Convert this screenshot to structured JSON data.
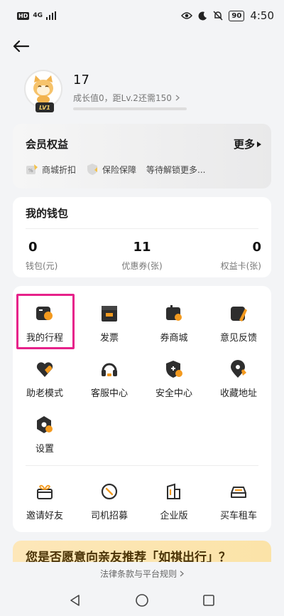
{
  "status_bar": {
    "network_badge": "HD",
    "network_type": "4G",
    "battery": "90",
    "time": "4:50"
  },
  "profile": {
    "username": "17",
    "growth_text": "成长值0，距Lv.2还需150",
    "level_badge": "LV1",
    "growth_progress": 0
  },
  "member": {
    "title": "会员权益",
    "more_label": "更多",
    "perks": [
      "商城折扣",
      "保险保障",
      "等待解锁更多..."
    ]
  },
  "wallet": {
    "title": "我的钱包",
    "stats": [
      {
        "value": "0",
        "label": "钱包(元)"
      },
      {
        "value": "11",
        "label": "优惠券(张)"
      },
      {
        "value": "0",
        "label": "权益卡(张)"
      }
    ]
  },
  "services": [
    {
      "label": "我的行程",
      "icon": "trip-icon"
    },
    {
      "label": "发票",
      "icon": "invoice-icon"
    },
    {
      "label": "券商城",
      "icon": "coupon-mall-icon"
    },
    {
      "label": "意见反馈",
      "icon": "feedback-icon"
    },
    {
      "label": "助老模式",
      "icon": "elder-mode-icon"
    },
    {
      "label": "客服中心",
      "icon": "headset-icon"
    },
    {
      "label": "安全中心",
      "icon": "shield-icon"
    },
    {
      "label": "收藏地址",
      "icon": "location-pin-icon"
    },
    {
      "label": "设置",
      "icon": "settings-icon"
    }
  ],
  "more_services": [
    {
      "label": "邀请好友",
      "icon": "gift-icon"
    },
    {
      "label": "司机招募",
      "icon": "steering-wheel-icon"
    },
    {
      "label": "企业版",
      "icon": "building-icon"
    },
    {
      "label": "买车租车",
      "icon": "car-icon"
    }
  ],
  "banner": {
    "text": "您是否愿意向亲友推荐「如祺出行」？"
  },
  "legal_link": "法律条款与平台规则",
  "colors": {
    "accent": "#f39a1f",
    "highlight": "#e6218a",
    "icon_dark": "#2e2e2e"
  }
}
